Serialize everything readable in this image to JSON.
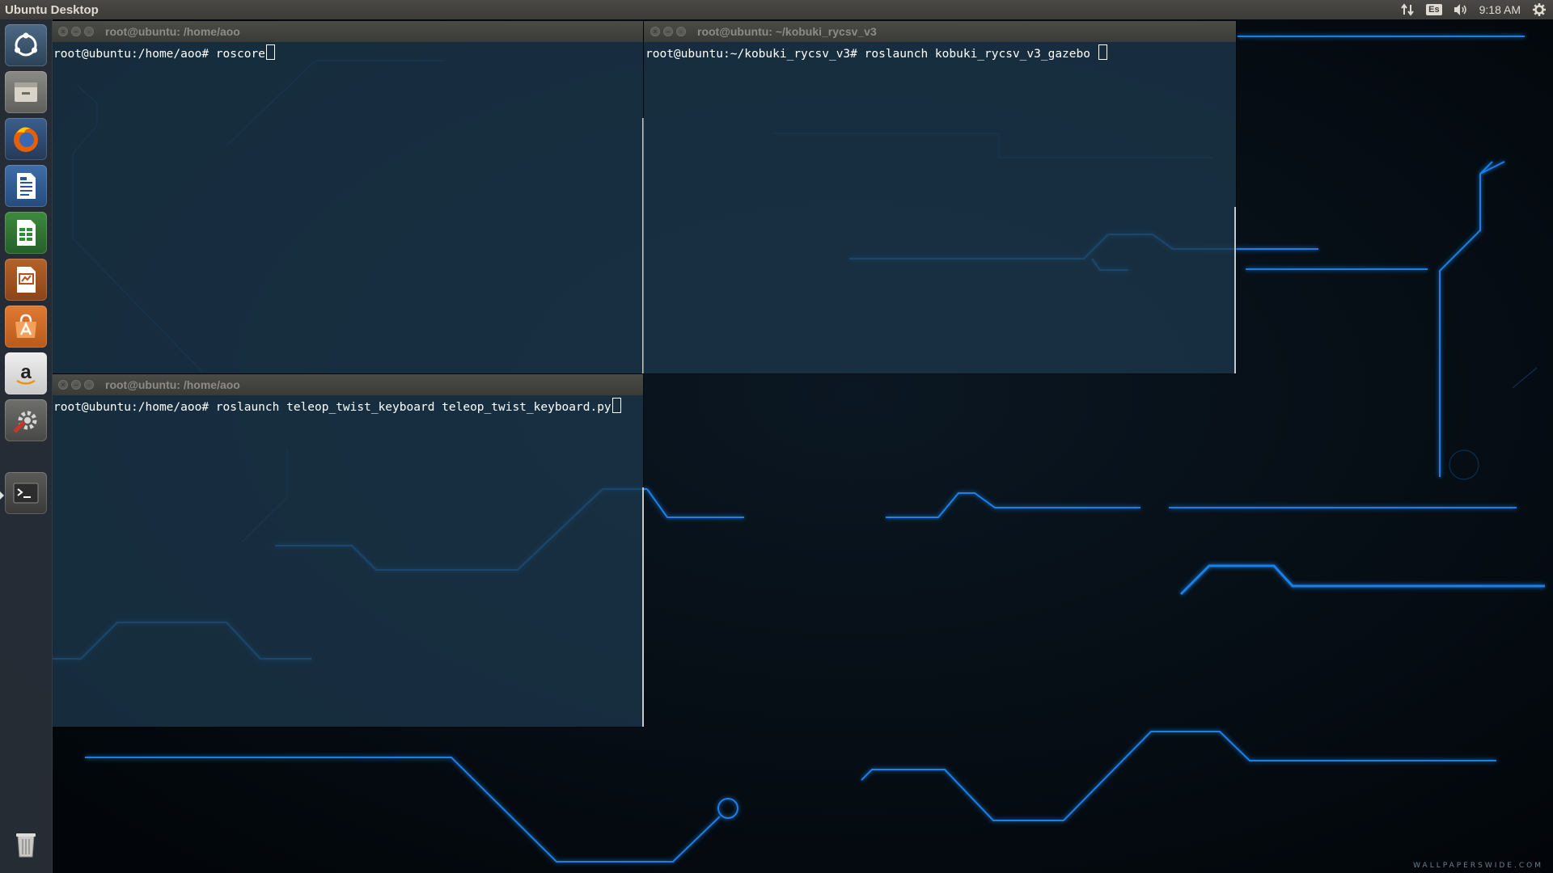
{
  "panel": {
    "title": "Ubuntu Desktop",
    "keyboard_layout": "Es",
    "clock": "9:18 AM",
    "icons": [
      "network-arrows-icon",
      "volume-icon",
      "gear-icon"
    ]
  },
  "launcher": {
    "items": [
      {
        "name": "dash-home-icon",
        "label": "Search your computer"
      },
      {
        "name": "files-icon",
        "label": "Files"
      },
      {
        "name": "firefox-icon",
        "label": "Firefox Web Browser"
      },
      {
        "name": "libreoffice-writer-icon",
        "label": "LibreOffice Writer"
      },
      {
        "name": "libreoffice-calc-icon",
        "label": "LibreOffice Calc"
      },
      {
        "name": "libreoffice-impress-icon",
        "label": "LibreOffice Impress"
      },
      {
        "name": "software-center-icon",
        "label": "Ubuntu Software Center"
      },
      {
        "name": "amazon-icon",
        "label": "Amazon"
      },
      {
        "name": "system-settings-icon",
        "label": "System Settings"
      },
      {
        "name": "terminal-icon",
        "label": "Terminal"
      },
      {
        "name": "trash-icon",
        "label": "Trash"
      }
    ]
  },
  "terminals": [
    {
      "title": "root@ubuntu: /home/aoo",
      "prompt": "root@ubuntu:/home/aoo# ",
      "command": "roscore"
    },
    {
      "title": "root@ubuntu: ~/kobuki_rycsv_v3",
      "prompt": "root@ubuntu:~/kobuki_rycsv_v3# ",
      "command": "roslaunch kobuki_rycsv_v3_gazebo "
    },
    {
      "title": "root@ubuntu: /home/aoo",
      "prompt": "root@ubuntu:/home/aoo# ",
      "command": "roslaunch teleop_twist_keyboard teleop_twist_keyboard.py"
    }
  ],
  "wallpaper": {
    "watermark": "WALLPAPERSWIDE.COM",
    "accent": "#1a8fff"
  }
}
